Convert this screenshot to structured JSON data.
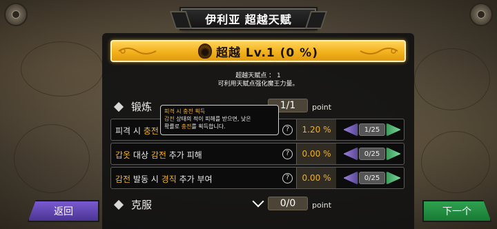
{
  "title": "伊利亚 超越天赋",
  "header": {
    "title": "超越 Lv.1 (0 %)"
  },
  "points": {
    "line1": "超越天赋点 ： 1",
    "line2": "可利用天赋点强化魔王力量。"
  },
  "sections": [
    {
      "title": "锻炼",
      "counter": "1/1",
      "unit": "point",
      "icon": "diamond-icon"
    },
    {
      "title": "克服",
      "counter": "0/0",
      "unit": "point",
      "icon": "diamond-icon",
      "expand_icon": "chevron-down-icon"
    }
  ],
  "talents": [
    {
      "name_parts": [
        "피격 시 ",
        "충전",
        " 획득"
      ],
      "value": "1.20 %",
      "level": "1/25"
    },
    {
      "name_parts": [
        "갑옷",
        " 대상 ",
        "감전",
        " 추가 피해"
      ],
      "value": "0.00 %",
      "level": "0/25"
    },
    {
      "name_parts": [
        "감전",
        " 발동 시 ",
        "경직",
        " 추가 부여"
      ],
      "value": "0.00 %",
      "level": "0/25"
    }
  ],
  "tooltip": {
    "title": "피격 시 충전 획득",
    "line1_a": "감전",
    "line1_b": " 상태의 적이 피해를 받으면, 낮은",
    "line2_a": "확률로 ",
    "line2_b": "충전",
    "line2_c": "를 획득합니다."
  },
  "help_glyph": "?",
  "buttons": {
    "back": "返回",
    "next": "下一个"
  },
  "colors": {
    "accent": "#f2b21c",
    "back": "#5b41b0",
    "next": "#1f8a3e"
  }
}
